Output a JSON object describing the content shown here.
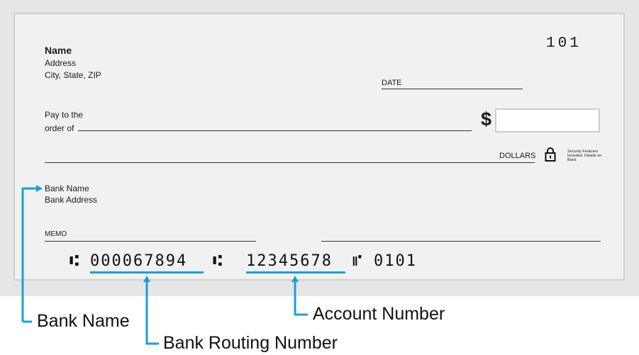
{
  "check": {
    "name": "Name",
    "address": "Address",
    "city_state_zip": "City, State, ZIP",
    "check_number": "101",
    "date_label": "DATE",
    "pay_to_line1": "Pay to the",
    "pay_to_line2": "order of",
    "dollar_sign": "$",
    "dollars_label": "DOLLARS",
    "security_text": "Security Features Included. Details on Back.",
    "bank_name": "Bank Name",
    "bank_address": "Bank Address",
    "memo_label": "MEMO",
    "micr": {
      "routing_symbol_left": "⑆",
      "routing_number": "000067894",
      "routing_symbol_right": "⑆",
      "account_number": "12345678",
      "on_us_symbol": "⑈",
      "check_number": "0101"
    }
  },
  "callouts": {
    "bank_name": "Bank Name",
    "account_number": "Account Number",
    "routing_number": "Bank Routing Number"
  },
  "colors": {
    "accent": "#1a9fd8",
    "check_face": "#f1f1f1",
    "check_border": "#cfcfcf",
    "background": "#e6e6e6"
  }
}
